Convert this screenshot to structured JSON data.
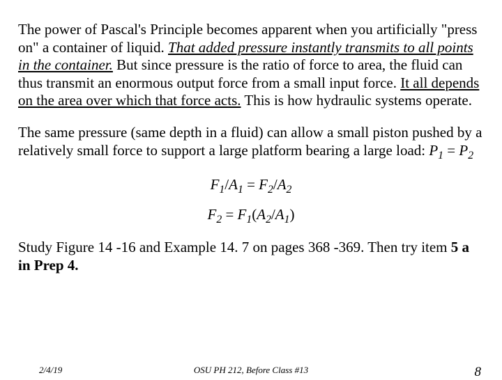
{
  "para1": {
    "t1": "The power of Pascal's Principle becomes apparent when you artificially \"press on\" a container of liquid.  ",
    "t2": "That added pressure instantly transmits to all points in the container.",
    "t3": "  But since pressure is the ratio of force to area, the fluid can thus transmit an enormous output force from a small input force.  ",
    "t4": "It all depends on the area over which that force acts.",
    "t5": "  This is how hydraulic systems operate."
  },
  "para2": {
    "t1": "The same pressure (same depth in a fluid) can allow a small piston pushed by a relatively small force to support a large platform bearing a large load:     ",
    "eq1": {
      "lhs_var": "P",
      "lhs_sub": "1",
      "eq": "  =  ",
      "rhs_var": "P",
      "rhs_sub": "2"
    }
  },
  "eq2": {
    "a": "F",
    "as": "1",
    "slash": "/",
    "b": "A",
    "bs": "1",
    "eq": "  =  ",
    "c": "F",
    "cs": "2",
    "slash2": "/",
    "d": "A",
    "ds": "2"
  },
  "eq3": {
    "a": "F",
    "as": "2",
    "eq": " = ",
    "b": "F",
    "bs": "1",
    "open": "(",
    "c": "A",
    "cs": "2",
    "slash": "/",
    "d": "A",
    "ds": "1",
    "close": ")"
  },
  "para3": {
    "t1": "Study Figure 14 -16 and Example 14. 7 on pages 368 -369. Then try item ",
    "t2": "5 a in Prep 4."
  },
  "footer": {
    "left": "2/4/19",
    "center": "OSU PH 212, Before Class #13",
    "right": "8"
  }
}
